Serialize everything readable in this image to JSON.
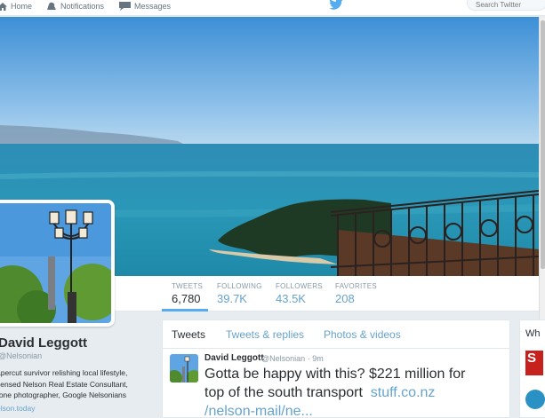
{
  "nav": {
    "home_label": "Home",
    "notifications_label": "Notifications",
    "messages_label": "Messages",
    "search_placeholder": "Search Twitter"
  },
  "stats": [
    {
      "label": "TWEETS",
      "value": "6,780"
    },
    {
      "label": "FOLLOWING",
      "value": "39.7K"
    },
    {
      "label": "FOLLOWERS",
      "value": "43.5K"
    },
    {
      "label": "FAVORITES",
      "value": "208"
    }
  ],
  "profile": {
    "name": "David Leggott",
    "handle": "@Nelsonian",
    "bio_lines": [
      "apercut survivor relishing local lifestyle,",
      "censed Nelson Real Estate Consultant,",
      "rone photographer, Google Nelsonians"
    ],
    "link": "elson.today"
  },
  "timeline": {
    "tabs": [
      "Tweets",
      "Tweets & replies",
      "Photos & videos"
    ],
    "active_tab": "Tweets"
  },
  "tweet": {
    "author": "David Leggott",
    "handle": "@Nelsonian",
    "time": "9m",
    "text_line1": "Gotta be happy with this? $221 million for",
    "text_line2_prefix": "top of the south transport",
    "link_line2": "stuff.co.nz",
    "link_line3": "/nelson-mail/ne..."
  },
  "sidebar": {
    "title_fragment": "Wh"
  },
  "colors": {
    "accent": "#55acee",
    "link": "#66a3cc",
    "text": "#292f33",
    "muted": "#8899a6"
  },
  "icons": [
    "home-icon",
    "bell-icon",
    "envelope-icon",
    "twitter-bird-icon"
  ]
}
